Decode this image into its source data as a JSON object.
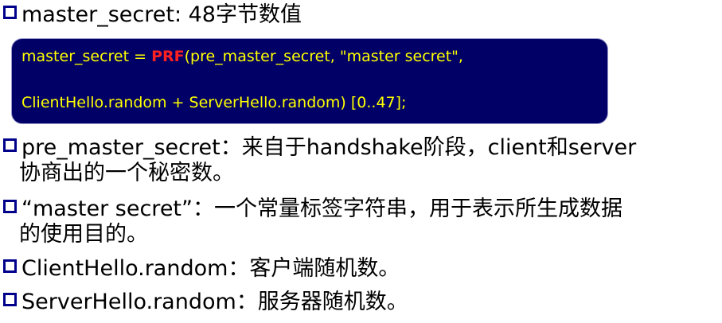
{
  "bullets": {
    "b1": {
      "text": "master_secret: 48字节数值"
    },
    "b2": {
      "line1": "pre_master_secret：来自于handshake阶段，client和server",
      "line2": "协商出的一个秘密数。"
    },
    "b3": {
      "line1": "“master  secret”：一个常量标签字符串，用于表示所生成数据",
      "line2": "的使用目的。"
    },
    "b4": {
      "text": "ClientHello.random：客户端随机数。"
    },
    "b5": {
      "text": "ServerHello.random：服务器随机数。"
    }
  },
  "formula": {
    "line1_prefix": "master_secret = ",
    "prf": "PRF",
    "line1_suffix": "(pre_master_secret, \"master secret\",",
    "line2": "ClientHello.random + ServerHello.random) [0..47];"
  },
  "colors": {
    "bullet_square": "#00008b",
    "box_background": "#000066",
    "formula_text": "#ffff00",
    "prf_highlight": "#ff2020"
  }
}
